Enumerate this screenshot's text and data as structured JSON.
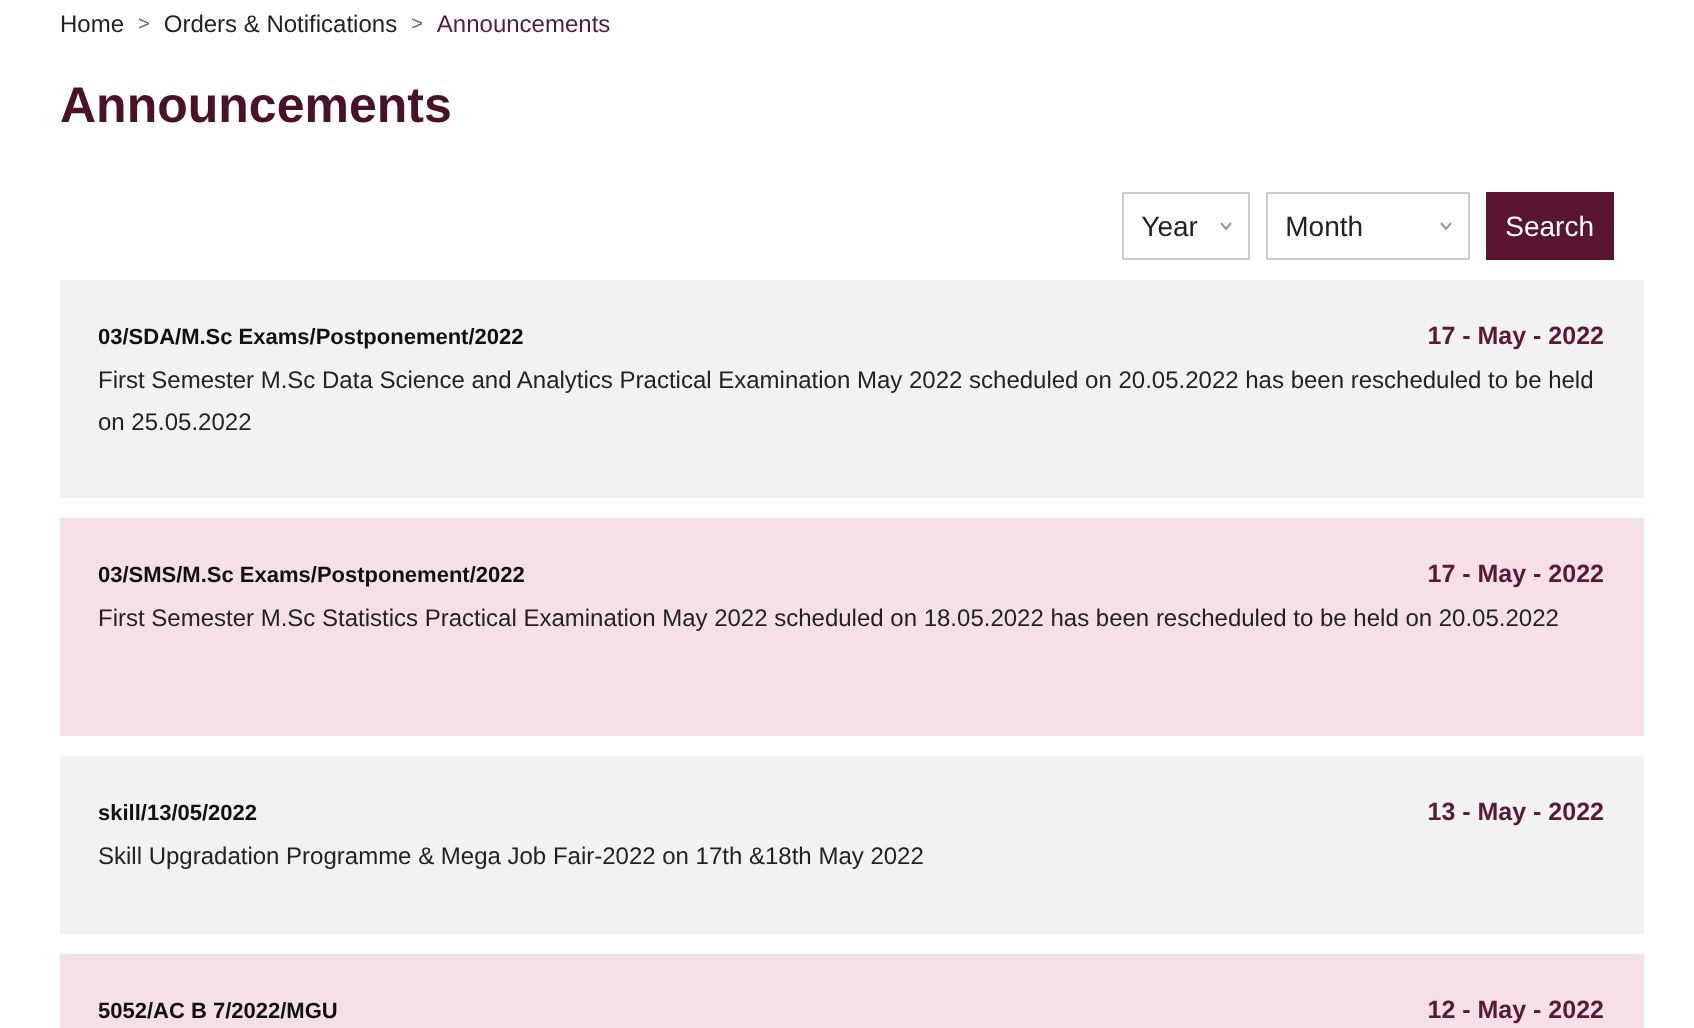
{
  "breadcrumb": [
    {
      "label": "Home",
      "selected": false
    },
    {
      "label": "Orders & Notifications",
      "selected": false
    },
    {
      "label": "Announcements",
      "selected": true
    }
  ],
  "breadcrumb_separator": ">",
  "title": "Announcements",
  "filters": {
    "year": "Year",
    "month": "Month",
    "search_button": "Search"
  },
  "announcements": [
    {
      "reference": "03/SDA/M.Sc Exams/Postponement/2022",
      "date": "17 - May - 2022",
      "text": "First Semester M.Sc Data Science and Analytics Practical Examination May 2022 scheduled on 20.05.2022 has been rescheduled to be held on 25.05.2022",
      "color": "#f2f2f2"
    },
    {
      "reference": "03/SMS/M.Sc Exams/Postponement/2022",
      "date": "17 - May - 2022",
      "text": "First Semester M.Sc Statistics Practical Examination May 2022 scheduled on 18.05.2022 has been rescheduled to be held on 20.05.2022",
      "color": "#f6e0e7"
    },
    {
      "reference": "skill/13/05/2022",
      "date": "13 - May - 2022",
      "text": "Skill Upgradation Programme & Mega Job Fair-2022 on 17th &18th May 2022",
      "color": "#f2f2f2"
    },
    {
      "reference": "5052/AC B 7/2022/MGU",
      "date": "12 - May - 2022",
      "color": "#f6e0e7"
    }
  ]
}
